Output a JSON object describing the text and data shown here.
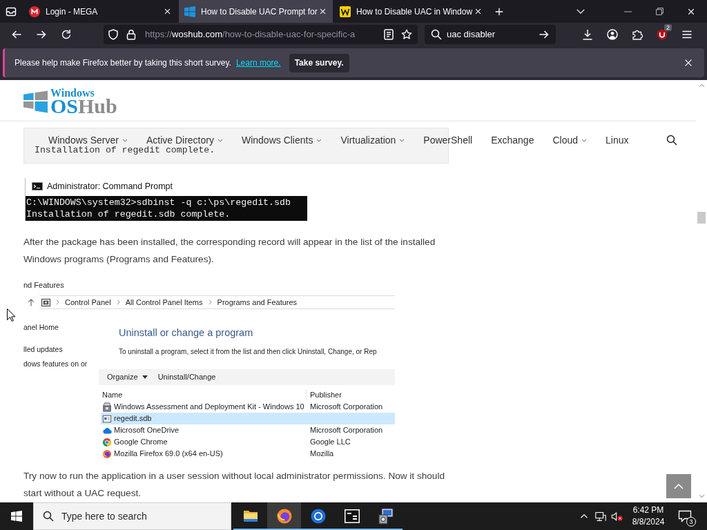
{
  "browser": {
    "tabs": [
      {
        "title": "Login - MEGA",
        "selected": false
      },
      {
        "title": "How to Disable UAC Prompt for",
        "selected": true
      },
      {
        "title": "How to Disable UAC in Window",
        "selected": false
      }
    ],
    "address": {
      "scheme": "https://",
      "host": "woshub.com",
      "path": "/how-to-disable-uac-for-specific-a"
    },
    "search": {
      "value": "uac disabler"
    },
    "extension_badge": "2"
  },
  "notification_bar": {
    "message": "Please help make Firefox better by taking this short survey.",
    "link": "Learn more.",
    "button": "Take survey."
  },
  "site": {
    "logo": {
      "tagline": "Windows",
      "wordmark": [
        {
          "text": "OS",
          "color": "#1b8fd0"
        },
        {
          "text": "Hub",
          "color": "#8c8c8c"
        }
      ]
    },
    "menu": [
      {
        "label": "Windows Server",
        "dropdown": true
      },
      {
        "label": "Active Directory",
        "dropdown": true
      },
      {
        "label": "Windows Clients",
        "dropdown": true
      },
      {
        "label": "Virtualization",
        "dropdown": true
      },
      {
        "label": "PowerShell",
        "dropdown": false
      },
      {
        "label": "Exchange",
        "dropdown": false
      },
      {
        "label": "Cloud",
        "dropdown": true
      },
      {
        "label": "Linux",
        "dropdown": false
      }
    ]
  },
  "article": [
    {
      "kind": "code",
      "text": "Installation of regedit complete."
    },
    {
      "kind": "console",
      "title": "Administrator: Command Prompt",
      "lines": [
        "C:\\WINDOWS\\system32>sdbinst -q c:\\ps\\regedit.sdb",
        "Installation of regedit.sdb complete."
      ]
    },
    {
      "kind": "paragraph",
      "text": "After the package has been installed, the corresponding record will appear in the list of the installed Windows programs (Programs and Features)."
    },
    {
      "kind": "programs_window",
      "title": "nd Features",
      "breadcrumb": [
        "Control Panel",
        "All Control Panel Items",
        "Programs and Features"
      ],
      "sidebar": [
        "anel Home",
        "lled updates",
        "dows features on or"
      ],
      "heading": "Uninstall or change a program",
      "instructions": "To uninstall a program, select it from the list and then click Uninstall, Change, or Rep",
      "toolbar": [
        {
          "label": "Organize",
          "dropdown": true
        },
        {
          "label": "Uninstall/Change",
          "dropdown": false
        }
      ],
      "columns": [
        "Name",
        "Publisher"
      ],
      "rows": [
        {
          "name": "Windows Assessment and Deployment Kit - Windows 10",
          "publisher": "Microsoft Corporation",
          "selected": false
        },
        {
          "name": "regedit.sdb",
          "selected": true
        },
        {
          "name": "Microsoft OneDrive",
          "publisher": "Microsoft Corporation",
          "selected": false
        },
        {
          "name": "Google Chrome",
          "publisher": "Google LLC",
          "selected": false
        },
        {
          "name": "Mozilla Firefox 69.0 (x64 en-US)",
          "publisher": "Mozilla",
          "selected": false
        }
      ]
    },
    {
      "kind": "paragraph",
      "text": "Try now to run the application in a user session without local administrator permissions. Now it should start without a UAC request."
    }
  ],
  "taskbar": {
    "search_placeholder": "Type here to search",
    "apps": [
      {
        "selected": false,
        "running": true
      },
      {
        "selected": true,
        "running": true
      },
      {
        "selected": false,
        "running": true
      },
      {
        "selected": false,
        "running": true
      },
      {
        "selected": false,
        "running": true
      }
    ],
    "clock": {
      "time": "6:42 PM",
      "date": "8/8/2024"
    },
    "notification_count": "3"
  }
}
